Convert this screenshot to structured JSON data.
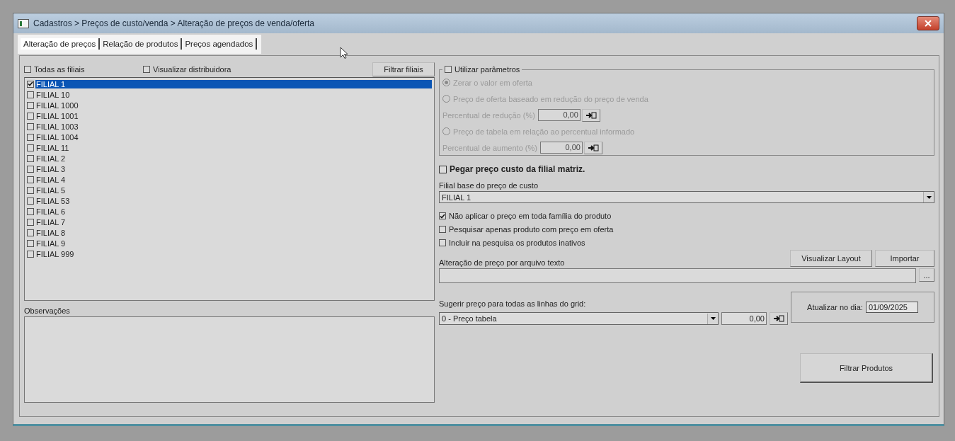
{
  "window": {
    "title": "Cadastros > Preços de custo/venda > Alteração de preços de venda/oferta"
  },
  "tabs": [
    {
      "label": "Alteração de preços",
      "selected": true
    },
    {
      "label": "Relação de produtos",
      "selected": false
    },
    {
      "label": "Preços agendados",
      "selected": false
    }
  ],
  "branches_panel": {
    "all_branches": {
      "label": "Todas as filiais",
      "checked": false
    },
    "show_distributor": {
      "label": "Visualizar distribuidora",
      "checked": false
    },
    "filter_button": "Filtrar filiais",
    "branches": [
      {
        "label": "FILIAL 1",
        "checked": true,
        "selected": true
      },
      {
        "label": "FILIAL 10",
        "checked": false,
        "selected": false
      },
      {
        "label": "FILIAL 1000",
        "checked": false,
        "selected": false
      },
      {
        "label": "FILIAL 1001",
        "checked": false,
        "selected": false
      },
      {
        "label": "FILIAL 1003",
        "checked": false,
        "selected": false
      },
      {
        "label": "FILIAL 1004",
        "checked": false,
        "selected": false
      },
      {
        "label": "FILIAL 11",
        "checked": false,
        "selected": false
      },
      {
        "label": "FILIAL 2",
        "checked": false,
        "selected": false
      },
      {
        "label": "FILIAL 3",
        "checked": false,
        "selected": false
      },
      {
        "label": "FILIAL 4",
        "checked": false,
        "selected": false
      },
      {
        "label": "FILIAL 5",
        "checked": false,
        "selected": false
      },
      {
        "label": "FILIAL 53",
        "checked": false,
        "selected": false
      },
      {
        "label": "FILIAL 6",
        "checked": false,
        "selected": false
      },
      {
        "label": "FILIAL 7",
        "checked": false,
        "selected": false
      },
      {
        "label": "FILIAL 8",
        "checked": false,
        "selected": false
      },
      {
        "label": "FILIAL 9",
        "checked": false,
        "selected": false
      },
      {
        "label": "FILIAL 999",
        "checked": false,
        "selected": false
      }
    ],
    "notes_label": "Observações"
  },
  "parameters": {
    "use_parameters": {
      "label": "Utilizar parâmetros",
      "checked": false
    },
    "options": [
      {
        "kind": "radio",
        "label": "Zerar o valor em oferta",
        "selected": true,
        "disabled": true
      },
      {
        "kind": "radio",
        "label": "Preço de oferta baseado em redução do preço de venda",
        "selected": false,
        "disabled": true
      },
      {
        "kind": "percent",
        "label": "Percentual de redução (%)",
        "value": "0,00",
        "disabled": true
      },
      {
        "kind": "radio",
        "label": "Preço de tabela em relação ao percentual informado",
        "selected": false,
        "disabled": true
      },
      {
        "kind": "percent",
        "label": "Percentual de aumento (%)",
        "value": "0,00",
        "disabled": true
      }
    ]
  },
  "cost": {
    "matrix_cost": {
      "label": "Pegar preço custo da filial matriz.",
      "checked": false
    },
    "base_label": "Filial base do preço de custo",
    "base_value": "FILIAL 1"
  },
  "flags": [
    {
      "label": "Não aplicar o preço em toda família do produto",
      "checked": true
    },
    {
      "label": "Pesquisar apenas produto com preço em oferta",
      "checked": false
    },
    {
      "label": "Incluir na pesquisa os produtos inativos",
      "checked": false
    }
  ],
  "file_import": {
    "buttons": [
      "Visualizar Layout",
      "Importar"
    ],
    "label": "Alteração de preço por arquivo texto",
    "browse_button": "..."
  },
  "suggest": {
    "label": "Sugerir preço para todas as linhas do grid:",
    "value": "0 - Preço tabela",
    "amount": "0,00"
  },
  "schedule": {
    "label": "Atualizar no dia:",
    "date": "01/09/2025"
  },
  "filter_products_button": "Filtrar  Produtos"
}
